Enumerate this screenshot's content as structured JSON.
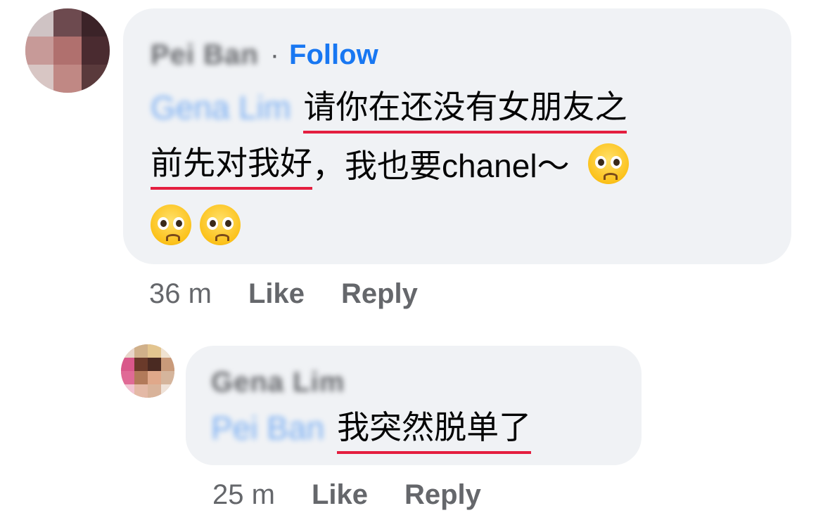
{
  "comment1": {
    "author": "Pei Ban",
    "separator": "·",
    "follow_label": "Follow",
    "mention": "Gena Lim",
    "text_underlined_1": "请你在还没有女朋友之",
    "text_underlined_2": "前先对我好",
    "text_rest": "，我也要chanel～",
    "emoji_name": "pleading-face-emoji",
    "timestamp": "36 m",
    "like_label": "Like",
    "reply_label": "Reply"
  },
  "comment2": {
    "author": "Gena Lim",
    "mention": "Pei Ban",
    "text": "我突然脱单了",
    "timestamp": "25 m",
    "like_label": "Like",
    "reply_label": "Reply"
  },
  "colors": {
    "bubble": "#f0f2f5",
    "link": "#1877f2",
    "meta": "#65676b",
    "underline": "#e41e3f"
  }
}
